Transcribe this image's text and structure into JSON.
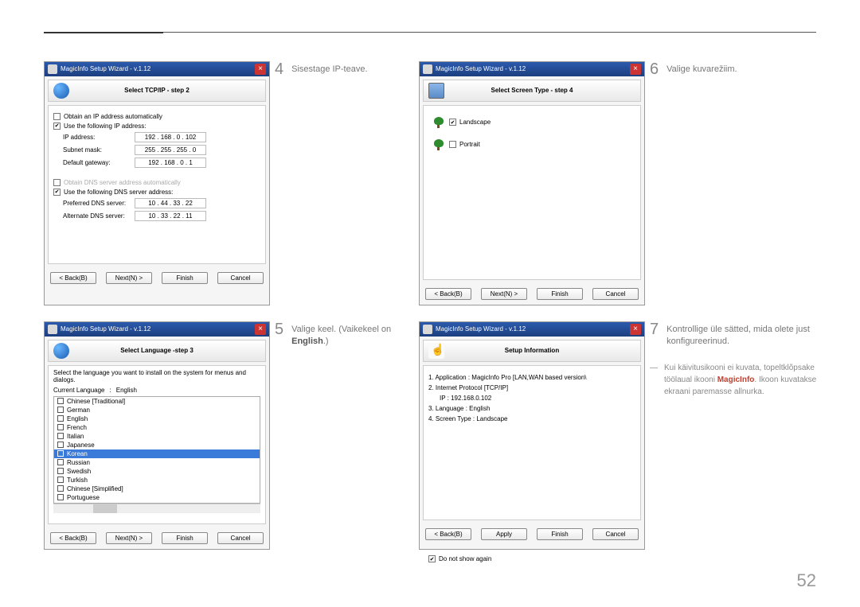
{
  "page_number": "52",
  "step4_num": "4",
  "step4_text": "Sisestage IP-teave.",
  "step5_num": "5",
  "step5_text_a": "Valige keel. (Vaikekeel on ",
  "step5_text_b": "English",
  "step5_text_c": ".)",
  "step6_num": "6",
  "step6_text": "Valige kuvarežiim.",
  "step7_num": "7",
  "step7_text": "Kontrollige üle sätted, mida olete just konfigureerinud.",
  "note_a": "Kui käivitusikooni ei kuvata, topeltklõpsake töölaual ikooni ",
  "note_b": "MagicInfo",
  "note_c": ". Ikoon kuvatakse ekraani paremasse allnurka.",
  "common": {
    "title": "MagicInfo Setup Wizard - v.1.12",
    "back": "< Back(B)",
    "next": "Next(N) >",
    "finish": "Finish",
    "cancel": "Cancel",
    "apply": "Apply"
  },
  "win1": {
    "header": "Select TCP/IP - step 2",
    "chk_auto_ip": "Obtain an IP address automatically",
    "chk_use_ip": "Use the following IP address:",
    "lbl_ip": "IP address:",
    "val_ip": "192 . 168 .  0  . 102",
    "lbl_subnet": "Subnet mask:",
    "val_subnet": "255 . 255 . 255 .  0",
    "lbl_gateway": "Default gateway:",
    "val_gateway": "192 . 168 .  0  .  1",
    "chk_auto_dns": "Obtain DNS server address automatically",
    "chk_use_dns": "Use the following DNS server address:",
    "lbl_pref_dns": "Preferred DNS server:",
    "val_pref_dns": "10 . 44 . 33 . 22",
    "lbl_alt_dns": "Alternate DNS server:",
    "val_alt_dns": "10 . 33 . 22 . 11"
  },
  "win2": {
    "header": "Select Language -step 3",
    "desc": "Select the language you want to install on the system for menus and dialogs.",
    "lbl_current": "Current Language",
    "val_current": "English",
    "languages": [
      "Chinese [Traditional]",
      "German",
      "English",
      "French",
      "Italian",
      "Japanese",
      "Korean",
      "Russian",
      "Swedish",
      "Turkish",
      "Chinese [Simplified]",
      "Portuguese"
    ],
    "selected_index": 6
  },
  "win3": {
    "header": "Select Screen Type - step 4",
    "landscape": "Landscape",
    "portrait": "Portrait"
  },
  "win4": {
    "header": "Setup Information",
    "l1": "1. Application :",
    "v1": "MagicInfo Pro [LAN,WAN based version\\",
    "l2": "2. Internet Protocol [TCP/IP]",
    "l2b": "IP :",
    "v2b": "192.168.0.102",
    "l3": "3. Language :",
    "v3": "English",
    "l4": "4. Screen Type :",
    "v4": "Landscape",
    "noshow": "Do not show again"
  }
}
